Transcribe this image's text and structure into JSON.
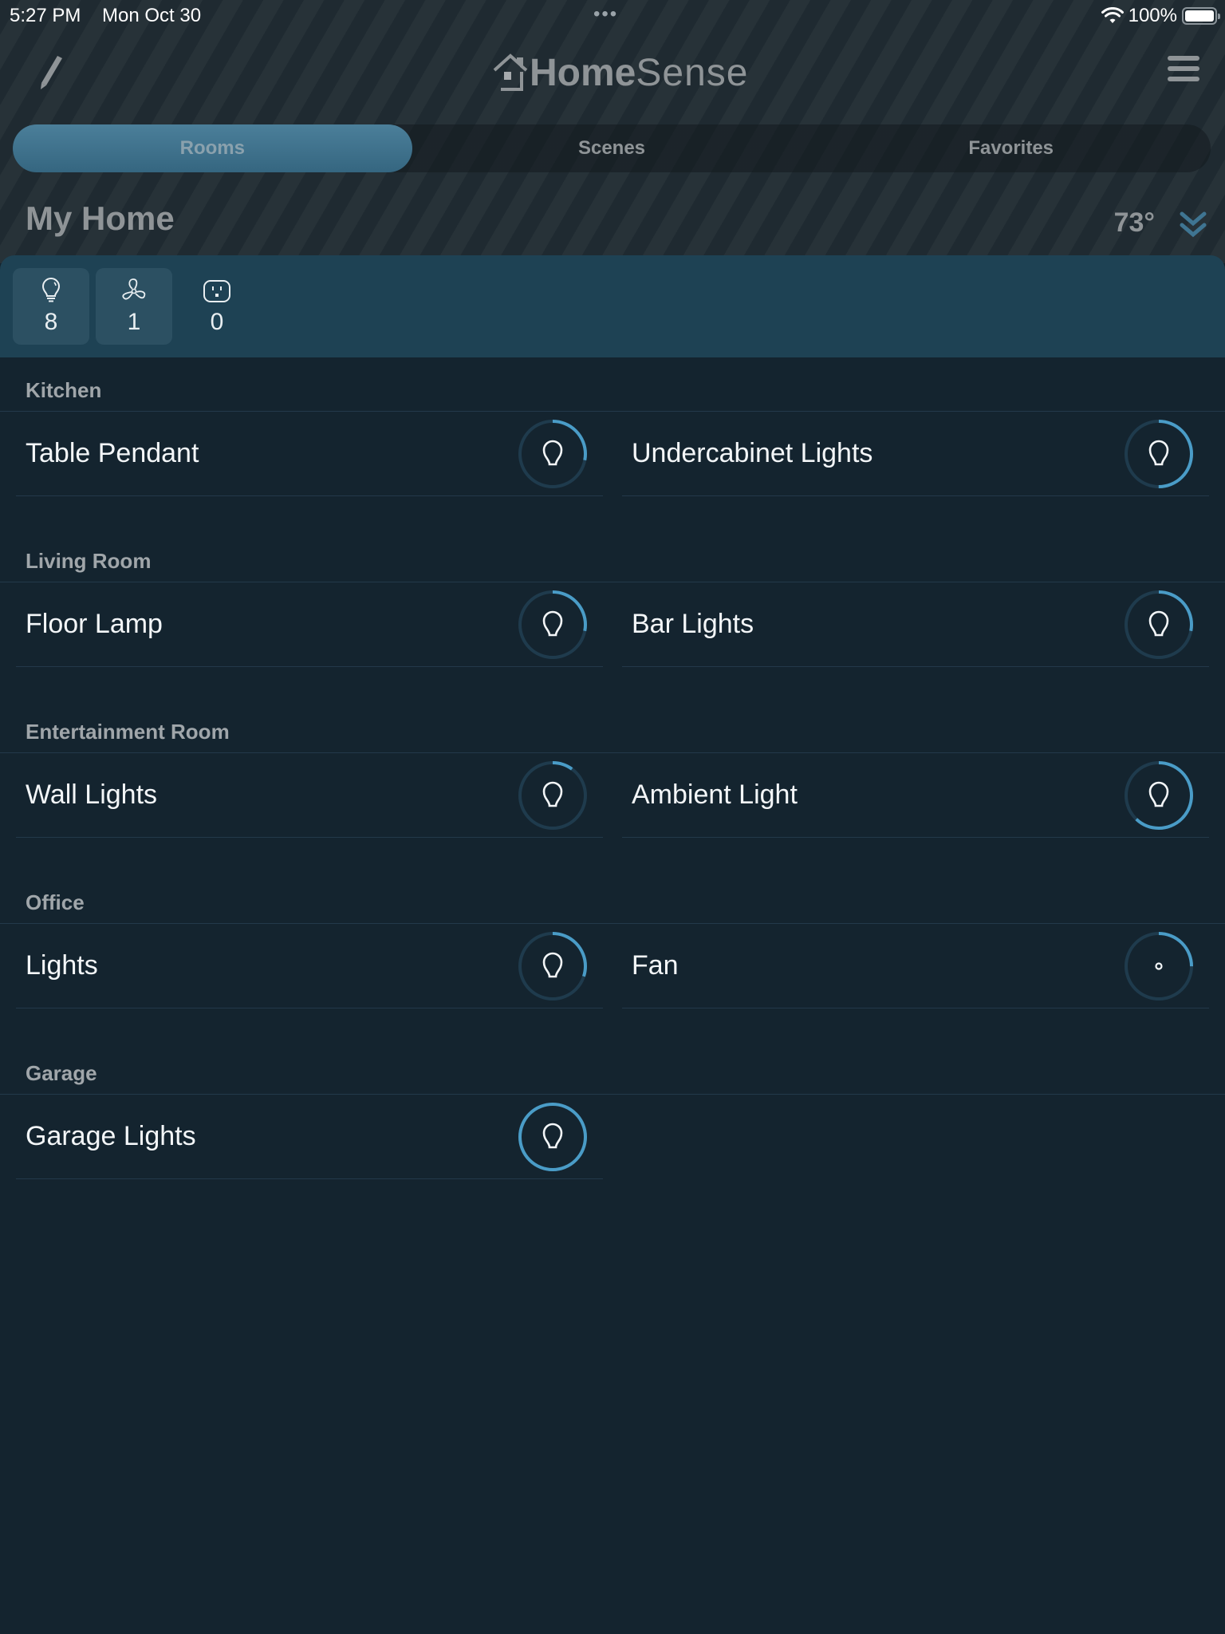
{
  "status_bar": {
    "time": "5:27 PM",
    "date": "Mon Oct 30",
    "dots": "•••",
    "battery_pct": "100%",
    "wifi_icon": "wifi-icon",
    "battery_icon": "battery-icon"
  },
  "nav": {
    "edit_icon": "pencil-icon",
    "logo_bold": "Home",
    "logo_light": "Sense",
    "menu_icon": "hamburger-menu-icon"
  },
  "tabs": [
    {
      "label": "Rooms",
      "active": true
    },
    {
      "label": "Scenes",
      "active": false
    },
    {
      "label": "Favorites",
      "active": false
    }
  ],
  "home": {
    "title": "My Home",
    "temperature": "73°",
    "expand_icon": "double-chevron-down-icon"
  },
  "summary": [
    {
      "icon": "lightbulb-icon",
      "count": "8"
    },
    {
      "icon": "fan-icon",
      "count": "1"
    },
    {
      "icon": "outlet-icon",
      "count": "0"
    }
  ],
  "colors": {
    "accent": "#4a9cc7",
    "ring_track": "#1f3b4d",
    "background": "#14242f",
    "summary_bg": "#1e4254"
  },
  "rooms": [
    {
      "name": "Kitchen",
      "devices": [
        {
          "name": "Table Pendant",
          "type": "light",
          "level": 0.28
        },
        {
          "name": "Undercabinet Lights",
          "type": "light",
          "level": 0.5
        }
      ]
    },
    {
      "name": "Living Room",
      "devices": [
        {
          "name": "Floor Lamp",
          "type": "light",
          "level": 0.28
        },
        {
          "name": "Bar Lights",
          "type": "light",
          "level": 0.28
        }
      ]
    },
    {
      "name": "Entertainment Room",
      "devices": [
        {
          "name": "Wall Lights",
          "type": "light",
          "level": 0.1
        },
        {
          "name": "Ambient Light",
          "type": "light",
          "level": 0.62
        }
      ]
    },
    {
      "name": "Office",
      "devices": [
        {
          "name": "Lights",
          "type": "light",
          "level": 0.3
        },
        {
          "name": "Fan",
          "type": "fan",
          "level": 0.25
        }
      ]
    },
    {
      "name": "Garage",
      "devices": [
        {
          "name": "Garage Lights",
          "type": "light",
          "level": 1.0
        }
      ]
    }
  ]
}
